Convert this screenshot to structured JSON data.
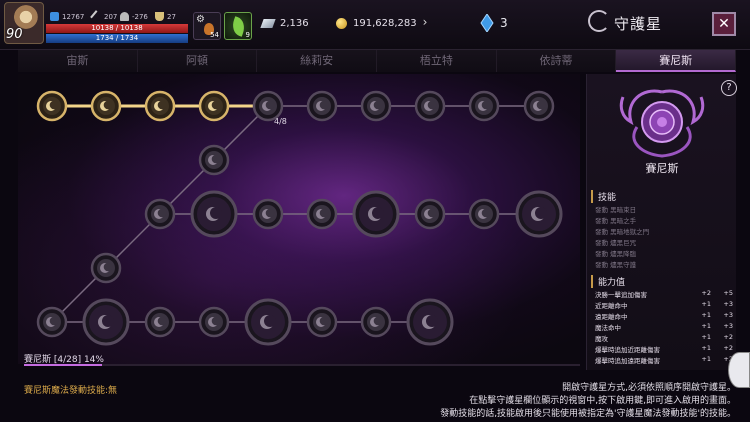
{
  "player": {
    "level": "90",
    "stat1": "12767",
    "stat2": "207",
    "stat3": "-276",
    "stat4": "27",
    "hp": "10138 / 10138",
    "mp": "1734 / 1734"
  },
  "slots": {
    "potion_count": "54",
    "item_count": "9"
  },
  "currency": {
    "crystal": "2,136",
    "gold": "191,628,283",
    "gems": "3"
  },
  "header": {
    "title": "守護星",
    "close": "✕",
    "next": "›"
  },
  "tabs": [
    "宙斯",
    "阿頓",
    "絲莉安",
    "梧立特",
    "依詩蒂",
    "賽尼斯"
  ],
  "active_tab": 5,
  "tree": {
    "node_counter": "4/8",
    "progress_label": "賽尼斯 [4/28] 14%",
    "progress_fraction": 0.14
  },
  "panel": {
    "help": "?",
    "name": "賽尼斯",
    "skills_title": "技能",
    "skills": [
      "發動 黑暗束日",
      "發動 黑暗之手",
      "發動 黑暗地獄之門",
      "發動 燼黑巨咒",
      "發動 燼黑降臨",
      "發動 燼黑守護"
    ],
    "attr_title": "能力值",
    "attrs": [
      {
        "name": "決勝一擊追加傷害",
        "v1": "+2",
        "v2": "+5"
      },
      {
        "name": "近距離命中",
        "v1": "+1",
        "v2": "+3"
      },
      {
        "name": "遠距離命中",
        "v1": "+1",
        "v2": "+3"
      },
      {
        "name": "魔法命中",
        "v1": "+1",
        "v2": "+3"
      },
      {
        "name": "魔攻",
        "v1": "+1",
        "v2": "+2"
      },
      {
        "name": "爆擊時追加近距離傷害",
        "v1": "+1",
        "v2": "+2"
      },
      {
        "name": "爆擊時追加遠距離傷害",
        "v1": "+1",
        "v2": "+2"
      }
    ]
  },
  "footer": {
    "left": "賽尼斯魔法發動技能:無",
    "notes": [
      "開啟守護星方式,必須依照順序開啟守護星。",
      "在點擊守護星欄位顯示的視窗中,按下啟用鍵,即可進入啟用的畫面。",
      "發動技能的話,技能啟用後只能使用被指定為'守護星魔法發動技能'的技能。"
    ]
  },
  "colors": {
    "accent": "#b36ad0",
    "active_node": "#d7b46a",
    "locked_node": "#3a3340",
    "hp": "#d63a3a",
    "mp": "#2f6fd0"
  }
}
